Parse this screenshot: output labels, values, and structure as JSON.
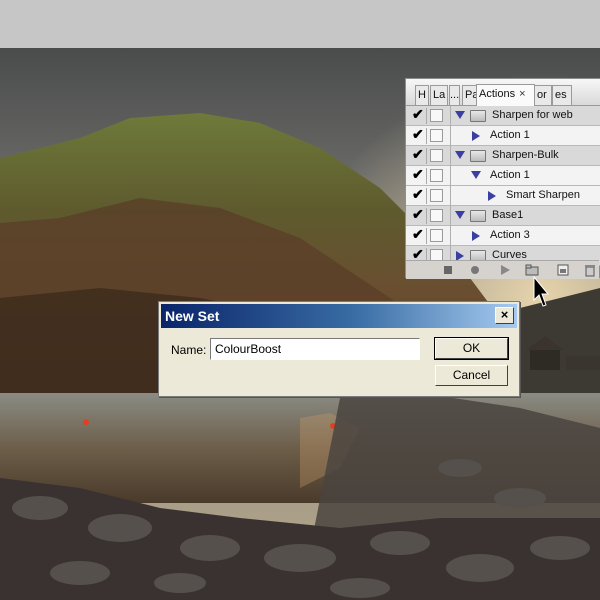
{
  "panel": {
    "tabs": [
      {
        "label": "H"
      },
      {
        "label": "La"
      },
      {
        "label": "..."
      },
      {
        "label": "Pa"
      },
      {
        "label": "Actions",
        "active": true
      },
      {
        "label": "×"
      },
      {
        "label": "or"
      },
      {
        "label": "es"
      }
    ],
    "rows": [
      {
        "label": "Sharpen for web",
        "kind": "set",
        "expanded": true,
        "checked": true
      },
      {
        "label": "Action 1",
        "kind": "action",
        "expanded": false,
        "checked": true
      },
      {
        "label": "Sharpen-Bulk",
        "kind": "set",
        "expanded": true,
        "checked": true
      },
      {
        "label": "Action 1",
        "kind": "action",
        "expanded": true,
        "checked": true
      },
      {
        "label": "Smart Sharpen",
        "kind": "step",
        "expanded": false,
        "checked": true
      },
      {
        "label": "Base1",
        "kind": "set",
        "expanded": true,
        "checked": true
      },
      {
        "label": "Action 3",
        "kind": "action",
        "expanded": false,
        "checked": true
      },
      {
        "label": "Curves",
        "kind": "set",
        "expanded": false,
        "checked": true
      }
    ],
    "toolbar_icons": [
      "stop-icon",
      "record-icon",
      "play-icon",
      "new-set-icon",
      "new-action-icon",
      "trash-icon"
    ]
  },
  "dialog": {
    "title": "New Set",
    "close_label": "×",
    "name_label": "Name:",
    "name_value": "ColourBoost",
    "ok_label": "OK",
    "cancel_label": "Cancel"
  },
  "colors": {
    "titlebar_start": "#0a246a",
    "titlebar_end": "#a6caf0",
    "dialog_bg": "#ece9d8",
    "triangle": "#3b3fa0"
  }
}
